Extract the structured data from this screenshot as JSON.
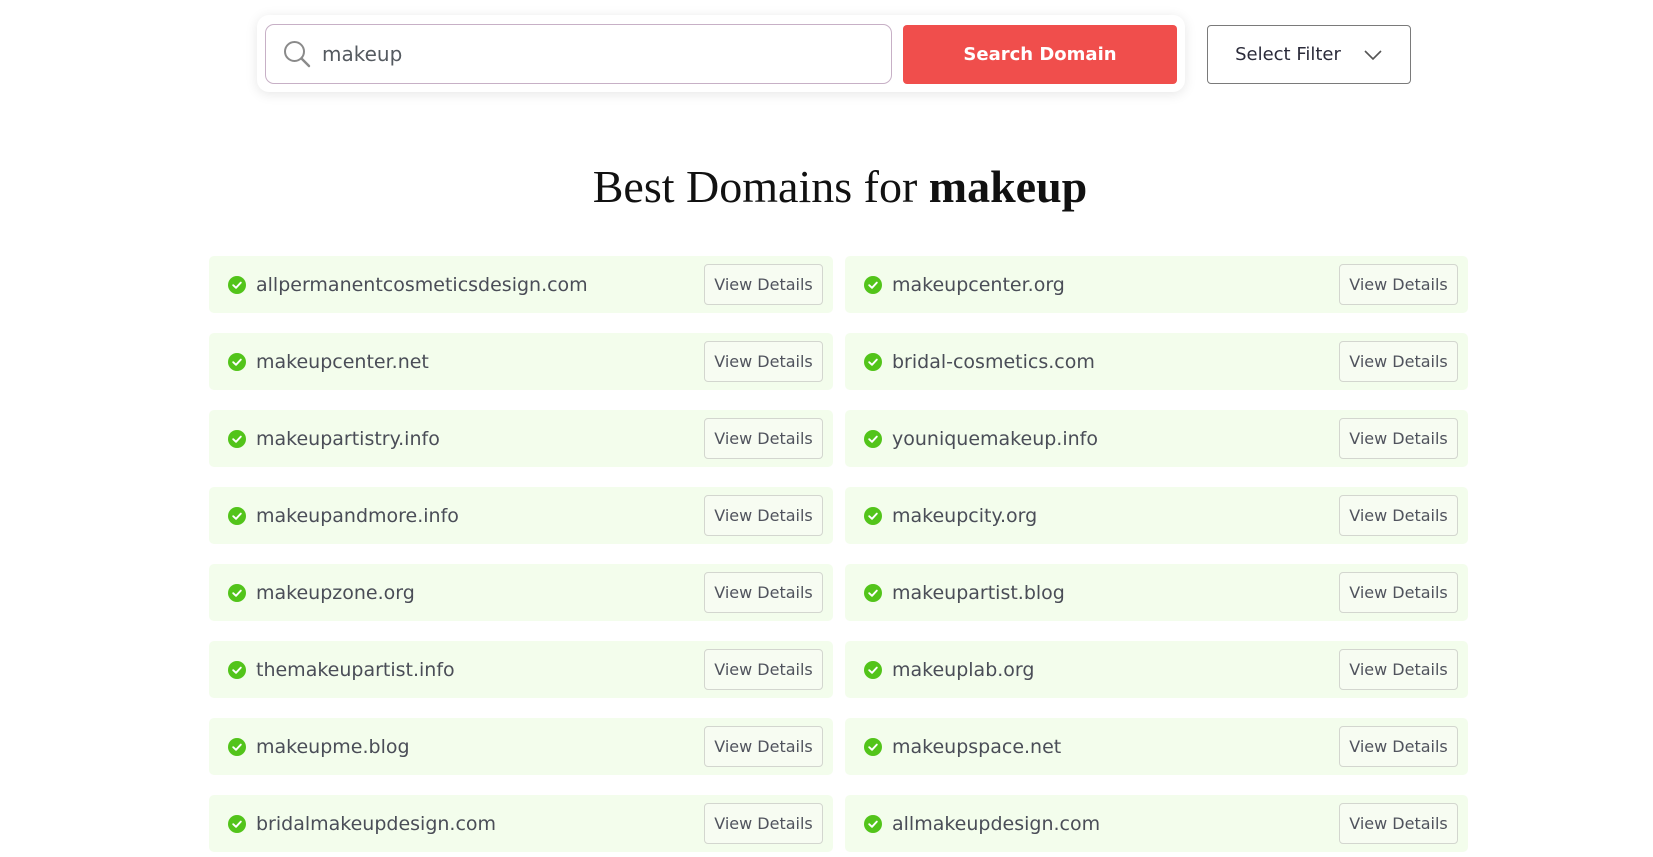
{
  "search": {
    "value": "makeup",
    "icon": "search-icon",
    "button_label": "Search Domain"
  },
  "filter": {
    "label": "Select Filter",
    "icon": "chevron-down-icon"
  },
  "heading": {
    "prefix": "Best Domains for",
    "keyword": "makeup"
  },
  "colors": {
    "accent": "#f04e4c",
    "available": "#52c41a",
    "card_bg": "#f3fdec"
  },
  "results": {
    "view_label": "View Details",
    "status_icon": "check-circle-icon",
    "left": [
      "allpermanentcosmeticsdesign.com",
      "makeupcenter.net",
      "makeupartistry.info",
      "makeupandmore.info",
      "makeupzone.org",
      "themakeupartist.info",
      "makeupme.blog",
      "bridalmakeupdesign.com"
    ],
    "right": [
      "makeupcenter.org",
      "bridal-cosmetics.com",
      "youniquemakeup.info",
      "makeupcity.org",
      "makeupartist.blog",
      "makeuplab.org",
      "makeupspace.net",
      "allmakeupdesign.com"
    ]
  }
}
